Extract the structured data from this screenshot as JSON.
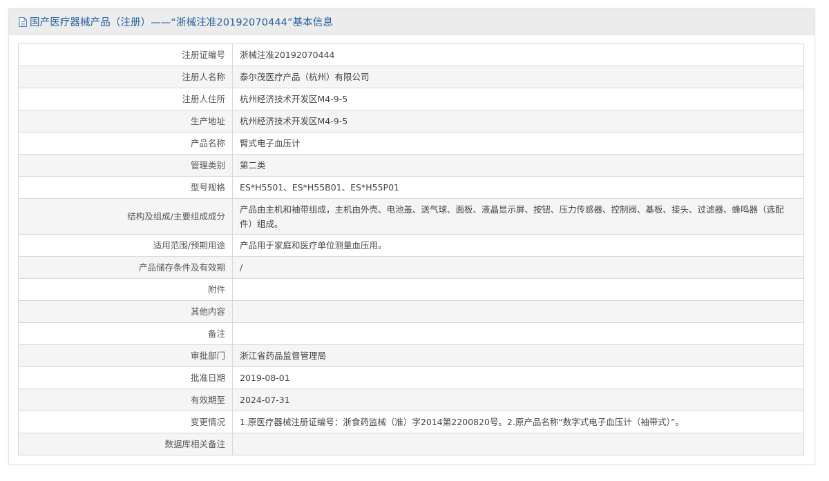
{
  "header": {
    "title": "国产医疗器械产品（注册）——“浙械注准20192070444”基本信息",
    "icon": "document-icon"
  },
  "rows": [
    {
      "label": "注册证编号",
      "value": "浙械注准20192070444"
    },
    {
      "label": "注册人名称",
      "value": "泰尔茂医疗产品（杭州）有限公司"
    },
    {
      "label": "注册人住所",
      "value": "杭州经济技术开发区M4-9-5"
    },
    {
      "label": "生产地址",
      "value": "杭州经济技术开发区M4-9-5"
    },
    {
      "label": "产品名称",
      "value": "臂式电子血压计"
    },
    {
      "label": "管理类别",
      "value": "第二类"
    },
    {
      "label": "型号规格",
      "value": "ES*H5501、ES*H55B01、ES*H55P01"
    },
    {
      "label": "结构及组成/主要组成成分",
      "value": "产品由主机和袖带组成，主机由外壳、电池盖、送气球、面板、液晶显示屏、按钮、压力传感器、控制阀、基板、接头、过滤器、蜂鸣器（选配件）组成。"
    },
    {
      "label": "适用范围/预期用途",
      "value": "产品用于家庭和医疗单位测量血压用。"
    },
    {
      "label": "产品储存条件及有效期",
      "value": "/"
    },
    {
      "label": "附件",
      "value": ""
    },
    {
      "label": "其他内容",
      "value": ""
    },
    {
      "label": "备注",
      "value": ""
    },
    {
      "label": "审批部门",
      "value": "浙江省药品监督管理局"
    },
    {
      "label": "批准日期",
      "value": "2019-08-01"
    },
    {
      "label": "有效期至",
      "value": "2024-07-31"
    },
    {
      "label": "变更情况",
      "value": "1.原医疗器械注册证编号：浙食药监械（准）字2014第2200820号。2.原产品名称“数字式电子血压计（袖带式）”。"
    },
    {
      "label": "数据库相关备注",
      "value": ""
    }
  ],
  "colors": {
    "title": "#1f5f9e",
    "header_bg": "#ececec",
    "row_alt_bg": "#f5f5f5",
    "border": "#d7d7d7"
  }
}
